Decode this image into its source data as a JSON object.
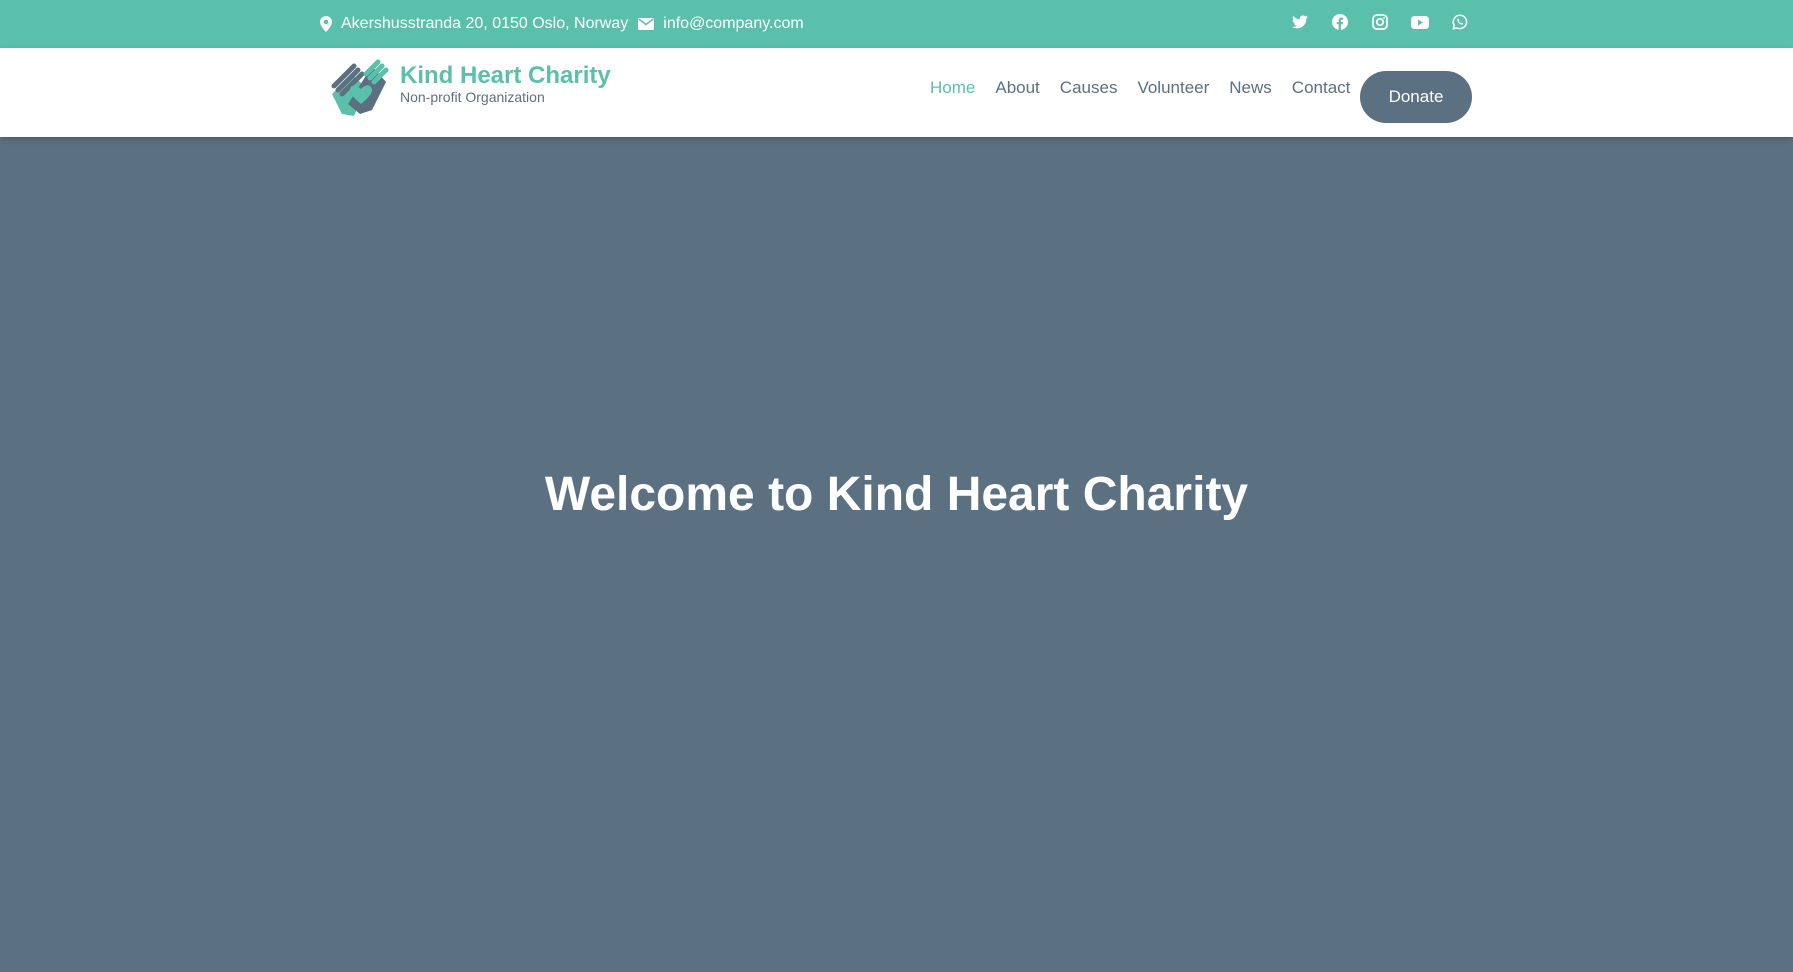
{
  "colors": {
    "accent": "#5bc0ab",
    "slate": "#5b7080",
    "white": "#ffffff"
  },
  "topbar": {
    "address": "Akershusstranda 20, 0150 Oslo, Norway",
    "email": "info@company.com",
    "address_icon": "map-marker-icon",
    "email_icon": "envelope-icon",
    "social": [
      "twitter-icon",
      "facebook-icon",
      "instagram-icon",
      "youtube-icon",
      "whatsapp-icon"
    ]
  },
  "brand": {
    "name": "Kind Heart Charity",
    "tagline": "Non-profit Organization",
    "logo_icon": "hands-heart-logo"
  },
  "nav": {
    "items": [
      "Home",
      "About",
      "Causes",
      "Volunteer",
      "News",
      "Contact"
    ],
    "active": "Home",
    "donate_label": "Donate"
  },
  "hero": {
    "title": "Welcome to Kind Heart Charity"
  }
}
